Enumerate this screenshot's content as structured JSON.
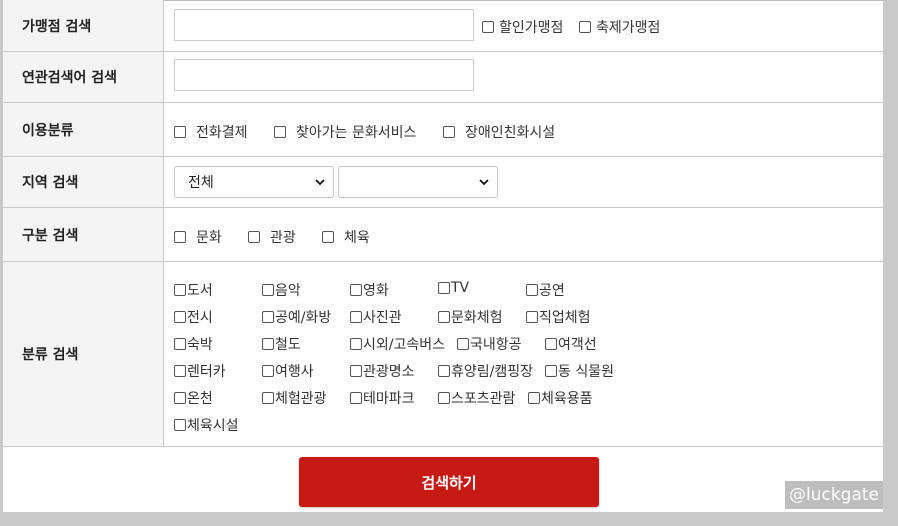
{
  "rows": {
    "store_search": {
      "label": "가맹점 검색",
      "input_value": "",
      "checks": [
        "할인가맹점",
        "축제가맹점"
      ]
    },
    "related_search": {
      "label": "연관검색어 검색",
      "input_value": ""
    },
    "usage_category": {
      "label": "이용분류",
      "checks": [
        "전화결제",
        "찾아가는 문화서비스",
        "장애인친화시설"
      ]
    },
    "region_search": {
      "label": "지역 검색",
      "select_primary": "전체",
      "select_secondary": ""
    },
    "type_search": {
      "label": "구분 검색",
      "checks": [
        "문화",
        "관광",
        "체육"
      ]
    },
    "class_search": {
      "label": "분류 검색",
      "checks": [
        "도서",
        "음악",
        "영화",
        "TV",
        "공연",
        "전시",
        "공예/화방",
        "사진관",
        "문화체험",
        "직업체험",
        "숙박",
        "철도",
        "시외/고속버스",
        "국내항공",
        "여객선",
        "렌터카",
        "여행사",
        "관광명소",
        "휴양림/캠핑장",
        "동 식물원",
        "온천",
        "체험관광",
        "테마파크",
        "스포츠관람",
        "체육용품",
        "체육시설"
      ]
    }
  },
  "search_button": "검색하기",
  "watermark": "@luckgate",
  "colors": {
    "button": "#c81a15",
    "background": "#c9c9c9",
    "header_cell": "#f4f4f4"
  },
  "icons": {
    "select_arrow": "chevron-down-icon"
  }
}
